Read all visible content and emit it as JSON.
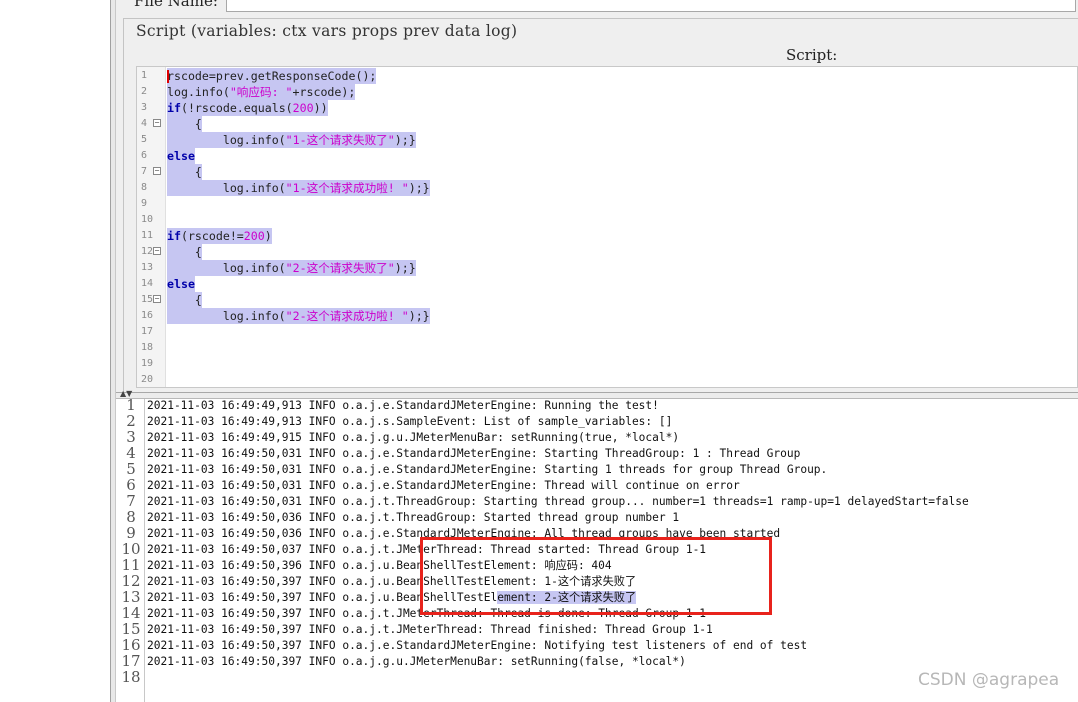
{
  "form": {
    "filename_label": "File Name:",
    "group_title": "Script (variables: ctx vars props prev data log)",
    "script_label": "Script:"
  },
  "editor": {
    "lines": [
      {
        "n": "1",
        "fold": "",
        "code": "rscode=prev.getResponseCode();"
      },
      {
        "n": "2",
        "fold": "",
        "code": "log.info(\"响应码: \"+rscode);"
      },
      {
        "n": "3",
        "fold": "",
        "code": "if(!rscode.equals(200))"
      },
      {
        "n": "4",
        "fold": "⊟",
        "code": "\t{"
      },
      {
        "n": "5",
        "fold": "",
        "code": "\t\tlog.info(\"1-这个请求失败了\");}"
      },
      {
        "n": "6",
        "fold": "",
        "code": "else"
      },
      {
        "n": "7",
        "fold": "⊟",
        "code": "\t{"
      },
      {
        "n": "8",
        "fold": "",
        "code": "\t\tlog.info(\"1-这个请求成功啦! \");}"
      },
      {
        "n": "9",
        "fold": "",
        "code": ""
      },
      {
        "n": "10",
        "fold": "",
        "code": ""
      },
      {
        "n": "11",
        "fold": "",
        "code": "if(rscode!=200)"
      },
      {
        "n": "12",
        "fold": "⊟",
        "code": "\t{"
      },
      {
        "n": "13",
        "fold": "",
        "code": "\t\tlog.info(\"2-这个请求失败了\");}"
      },
      {
        "n": "14",
        "fold": "",
        "code": "else"
      },
      {
        "n": "15",
        "fold": "⊟",
        "code": "\t{"
      },
      {
        "n": "16",
        "fold": "",
        "code": "\t\tlog.info(\"2-这个请求成功啦! \");}"
      },
      {
        "n": "17",
        "fold": "",
        "code": ""
      },
      {
        "n": "18",
        "fold": "",
        "code": ""
      },
      {
        "n": "19",
        "fold": "",
        "code": ""
      },
      {
        "n": "20",
        "fold": "",
        "code": ""
      }
    ]
  },
  "log": {
    "lines": [
      {
        "n": "1",
        "text": "2021-11-03 16:49:49,913 INFO o.a.j.e.StandardJMeterEngine: Running the test!"
      },
      {
        "n": "2",
        "text": "2021-11-03 16:49:49,913 INFO o.a.j.s.SampleEvent: List of sample_variables: []"
      },
      {
        "n": "3",
        "text": "2021-11-03 16:49:49,915 INFO o.a.j.g.u.JMeterMenuBar: setRunning(true, *local*)"
      },
      {
        "n": "4",
        "text": "2021-11-03 16:49:50,031 INFO o.a.j.e.StandardJMeterEngine: Starting ThreadGroup: 1 : Thread Group"
      },
      {
        "n": "5",
        "text": "2021-11-03 16:49:50,031 INFO o.a.j.e.StandardJMeterEngine: Starting 1 threads for group Thread Group."
      },
      {
        "n": "6",
        "text": "2021-11-03 16:49:50,031 INFO o.a.j.e.StandardJMeterEngine: Thread will continue on error"
      },
      {
        "n": "7",
        "text": "2021-11-03 16:49:50,031 INFO o.a.j.t.ThreadGroup: Starting thread group... number=1 threads=1 ramp-up=1 delayedStart=false"
      },
      {
        "n": "8",
        "text": "2021-11-03 16:49:50,036 INFO o.a.j.t.ThreadGroup: Started thread group number 1"
      },
      {
        "n": "9",
        "text": "2021-11-03 16:49:50,036 INFO o.a.j.e.StandardJMeterEngine: All thread groups have been started"
      },
      {
        "n": "10",
        "text": "2021-11-03 16:49:50,037 INFO o.a.j.t.JMeterThread: Thread started: Thread Group 1-1"
      },
      {
        "n": "11",
        "text": "2021-11-03 16:49:50,396 INFO o.a.j.u.BeanShellTestElement: 响应码: 404"
      },
      {
        "n": "12",
        "text": "2021-11-03 16:49:50,397 INFO o.a.j.u.BeanShellTestElement: 1-这个请求失败了"
      },
      {
        "n": "13",
        "text": "2021-11-03 16:49:50,397 INFO o.a.j.u.BeanShellTestEl",
        "sel": "ement: 2-这个请求失败了"
      },
      {
        "n": "14",
        "text": "2021-11-03 16:49:50,397 INFO o.a.j.t.JMeterThread: Thread is done: Thread Group 1-1"
      },
      {
        "n": "15",
        "text": "2021-11-03 16:49:50,397 INFO o.a.j.t.JMeterThread: Thread finished: Thread Group 1-1"
      },
      {
        "n": "16",
        "text": "2021-11-03 16:49:50,397 INFO o.a.j.e.StandardJMeterEngine: Notifying test listeners of end of test"
      },
      {
        "n": "17",
        "text": "2021-11-03 16:49:50,397 INFO o.a.j.g.u.JMeterMenuBar: setRunning(false, *local*)"
      },
      {
        "n": "18",
        "text": ""
      }
    ]
  },
  "watermark": "CSDN @agrapea",
  "colors": {
    "highlight": "#c6c6f2",
    "annotation_box": "#e8231c"
  }
}
